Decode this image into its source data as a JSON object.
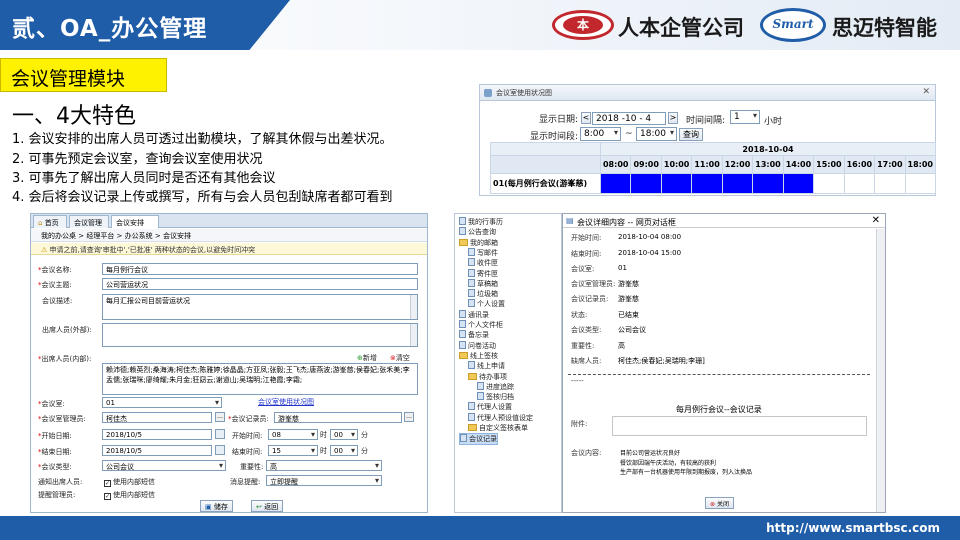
{
  "header": {
    "slide_title": "贰、OA_办公管理",
    "logo1_badge": "本",
    "logo1_name": "人本企管公司",
    "logo2_badge": "Smart",
    "logo2_name": "思迈特智能"
  },
  "module_tag": "会议管理模块",
  "features": {
    "title": "一、4大特色",
    "items": [
      "1. 会议安排的出席人员可透过出勤模块，了解其休假与出差状况。",
      "2. 可事先预定会议室，查询会议室使用状况",
      "3. 可事先了解出席人员同时是否还有其他会议",
      "4. 会后将会议记录上传或撰写，所有与会人员包刮缺席者都可看到"
    ]
  },
  "room_window": {
    "title": "会议室使用状况图",
    "close": "✕",
    "date_label": "显示日期:",
    "date_value": "2018 -10 -  4",
    "prev": "<",
    "next": ">",
    "interval_label": "时间间隔:",
    "interval_value": "1",
    "interval_unit": "小时",
    "period_label": "显示时间段:",
    "start_time": "8:00",
    "dash": "~",
    "end_time": "18:00",
    "query_btn": "查询",
    "date_header": "2018-10-04",
    "hours": [
      "08:00",
      "09:00",
      "10:00",
      "11:00",
      "12:00",
      "13:00",
      "14:00",
      "15:00",
      "16:00",
      "17:00",
      "18:00"
    ],
    "booking_label": "01(每月例行会议(游峯慈)",
    "booked": [
      true,
      true,
      true,
      true,
      true,
      true,
      true,
      false,
      false,
      false,
      false
    ]
  },
  "form_window": {
    "tab_home": "首页",
    "tab_mgmt": "会议管理",
    "tab_arrange": "会议安排",
    "breadcrumb": "我的办公桌 > 经理平台 > 办公系统 > 会议安排",
    "notice": "申请之前,请查询'审批中','已批准' 两种状态的会议,以避免时间冲突",
    "name_label": "会议名称:",
    "name_value": "每月例行会议",
    "subject_label": "会议主题:",
    "subject_value": "公司营运状况",
    "desc_label": "会议描述:",
    "desc_value": "每月汇报公司目前营运状况",
    "ext_label": "出席人员(外部):",
    "int_label": "出席人员(内部):",
    "add_btn": "新增",
    "clear_btn": "清空",
    "attendees": "赖沛德;赖英烈;桑海涛;柯佳杰;陈雅婷;徐晶晶;方亚凤;张毅;王飞杰;唐燕波;游峯慈;侯春妃;张禾美;李孟儒;张瑞咪;廖绮耀;朱月金;狂窈云;谢道山;吴瑞明;江艳霞;李霜;",
    "room_label": "会议室:",
    "room_value": "01",
    "room_link": "会议室使用状况图",
    "mgr_label": "会议室管理员:",
    "mgr_value": "柯佳杰",
    "rec_label": "会议记录员:",
    "rec_value": "游峯慈",
    "start_date_label": "开始日期:",
    "start_date_value": "2018/10/5",
    "start_time_label": "开始时间:",
    "start_hour": "08",
    "hour_unit": "时",
    "start_min": "00",
    "min_unit": "分",
    "end_date_label": "结束日期:",
    "end_date_value": "2018/10/5",
    "end_time_label": "结束时间:",
    "end_hour": "15",
    "end_min": "00",
    "type_label": "会议类型:",
    "type_value": "公司会议",
    "importance_label": "重要性:",
    "importance_value": "高",
    "notify_label": "通知出席人员:",
    "notify_opt": "使用内部短信",
    "reminder_label": "消息提醒:",
    "reminder_value": "立即提醒",
    "remind_mgr_label": "提醒管理员:",
    "remind_mgr_opt": "使用内部短信",
    "save_btn": "储存",
    "back_btn": "返回"
  },
  "tree": {
    "items": [
      "我的行事历",
      "公告查询",
      "我的邮箱",
      "写邮件",
      "收件匣",
      "寄件匣",
      "草稿箱",
      "垃圾箱",
      "个人设置",
      "通讯录",
      "个人文件柜",
      "备忘录",
      "问卷活动",
      "线上签核",
      "线上申请",
      "待办事项",
      "进度追踪",
      "签核归档",
      "代理人设置",
      "代理人预设值设定",
      "自定义签核表单",
      "会议记录"
    ]
  },
  "detail": {
    "title": "会议详细内容 -- 网页对话框",
    "start_label": "开始时间:",
    "start_value": "2018-10-04 08:00",
    "end_label": "结束时间:",
    "end_value": "2018-10-04 15:00",
    "room_label": "会议室:",
    "room_value": "01",
    "mgr_label": "会议室管理员:",
    "mgr_value": "游峯慈",
    "rec_label": "会议记录员:",
    "rec_value": "游峯慈",
    "status_label": "状态:",
    "status_value": "已结束",
    "type_label": "会议类型:",
    "type_value": "公司会议",
    "imp_label": "重要性:",
    "imp_value": "高",
    "absent_label": "缺席人员:",
    "absent_value": "柯佳杰;侯春妃;吴瑞明;李珊]",
    "ellipsis": "-----",
    "record_title": "每月例行会议--会议记录",
    "attach_label": "附件:",
    "content_label": "会议内容:",
    "content_lines": [
      "目前公司营运状况良好",
      "餐饮部因端午庆活动，有较高的获利",
      "生产部有一台机器使用年限到期报废，列入汰换品"
    ],
    "close_btn": "关闭"
  },
  "footer": {
    "url": "http://www.smartbsc.com"
  },
  "colors": {
    "brand_blue": "#1f5da8",
    "highlight_yellow": "#fff200",
    "booking_blue": "#0000ff",
    "logo_red": "#c2272d"
  }
}
